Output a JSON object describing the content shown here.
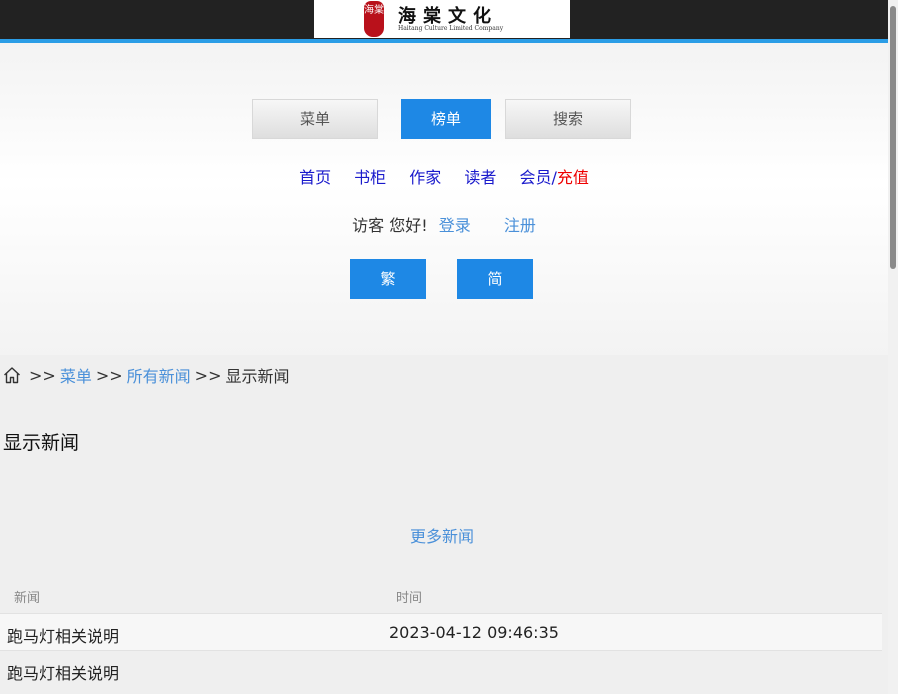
{
  "header": {
    "logo_seal": "海棠",
    "logo_title": "海棠文化",
    "logo_subtitle": "Haitang Culture Limited Company"
  },
  "tabs": [
    {
      "label": "菜单",
      "active": false
    },
    {
      "label": "榜单",
      "active": true
    },
    {
      "label": "搜索",
      "active": false
    }
  ],
  "nav_links": {
    "home": "首页",
    "bookshelf": "书柜",
    "authors": "作家",
    "readers": "读者",
    "member": "会员",
    "slash": "/",
    "recharge": "充值"
  },
  "welcome": {
    "greeting": "访客 您好!",
    "login": "登录",
    "register": "注册"
  },
  "lang_buttons": {
    "traditional": "繁",
    "simplified": "简"
  },
  "breadcrumb": {
    "sep": ">>",
    "menu": "菜单",
    "all_news": "所有新闻",
    "current": "显示新闻"
  },
  "page_title": "显示新闻",
  "more_news": "更多新闻",
  "table": {
    "headers": {
      "news": "新闻",
      "time": "时间"
    },
    "rows": [
      {
        "title": "跑马灯相关说明",
        "time": "2023-04-12 09:46:35"
      },
      {
        "title": "跑马灯相关说明",
        "time": ""
      }
    ]
  },
  "colors": {
    "accent": "#1e88e5",
    "link": "#4a90d9",
    "nav_link": "#1a1acc",
    "recharge": "#ee0000"
  }
}
